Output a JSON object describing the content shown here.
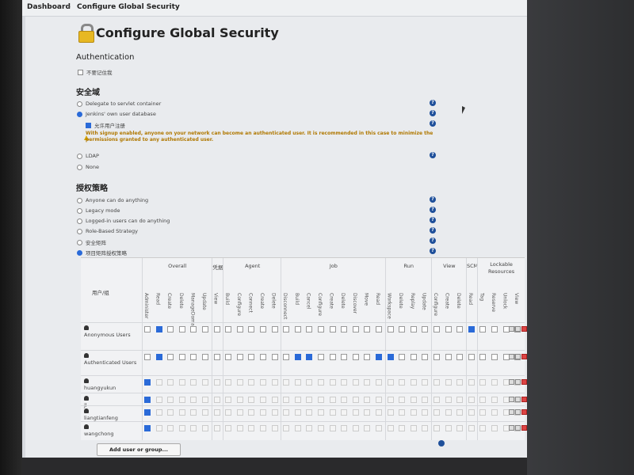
{
  "breadcrumb": {
    "home": "Dashboard",
    "current": "Configure Global Security"
  },
  "page": {
    "title": "Configure Global Security"
  },
  "authentication": {
    "heading": "Authentication",
    "disable_remember_me": "不要记住我"
  },
  "security_realm": {
    "heading": "安全域",
    "options": [
      "Delegate to servlet container",
      "Jenkins' own user database",
      "LDAP",
      "None"
    ],
    "selected": "Jenkins' own user database",
    "allow_signup": "允许用户注册",
    "warning": "With signup enabled, anyone on your network can become an authenticated user. It is recommended in this case to minimize the permissions granted to any authenticated user."
  },
  "authorization": {
    "heading": "授权策略",
    "options": [
      "Anyone can do anything",
      "Legacy mode",
      "Logged-in users can do anything",
      "Role-Based Strategy",
      "安全矩阵",
      "项目矩阵授权策略"
    ],
    "selected": "项目矩阵授权策略"
  },
  "matrix": {
    "user_group_header": "用户/组",
    "groups": [
      {
        "name": "Overall"
      },
      {
        "name": "凭据"
      },
      {
        "name": "Agent"
      },
      {
        "name": "Job"
      },
      {
        "name": "Run"
      },
      {
        "name": "View"
      },
      {
        "name": "SCM"
      },
      {
        "name": "Lockable Resources"
      }
    ],
    "columns": [
      "Administer",
      "Read",
      "Create",
      "Delete",
      "ManageDomains",
      "Update",
      "View",
      "Build",
      "Configure",
      "Connect",
      "Create",
      "Delete",
      "Disconnect",
      "Build",
      "Cancel",
      "Configure",
      "Create",
      "Delete",
      "Discover",
      "Move",
      "Read",
      "Workspace",
      "Delete",
      "Replay",
      "Update",
      "Configure",
      "Create",
      "Delete",
      "Read",
      "Tag",
      "Reserve",
      "Unlock",
      "View"
    ],
    "rows": [
      {
        "name": "Anonymous Users",
        "checked": [
          1,
          28
        ]
      },
      {
        "name": "Authenticated Users",
        "checked": [
          1,
          13,
          14,
          20,
          21
        ]
      },
      {
        "name": "huangyukun",
        "checked": [
          0
        ]
      },
      {
        "name": "jl",
        "checked": [
          0
        ]
      },
      {
        "name": "liangtianfeng",
        "checked": [
          0
        ]
      },
      {
        "name": "wangchong",
        "checked": [
          0
        ]
      }
    ]
  },
  "buttons": {
    "add_user": "Add user or group..."
  },
  "icons": {
    "help": "help-icon",
    "lock": "lock-icon",
    "warning": "warning-icon"
  }
}
